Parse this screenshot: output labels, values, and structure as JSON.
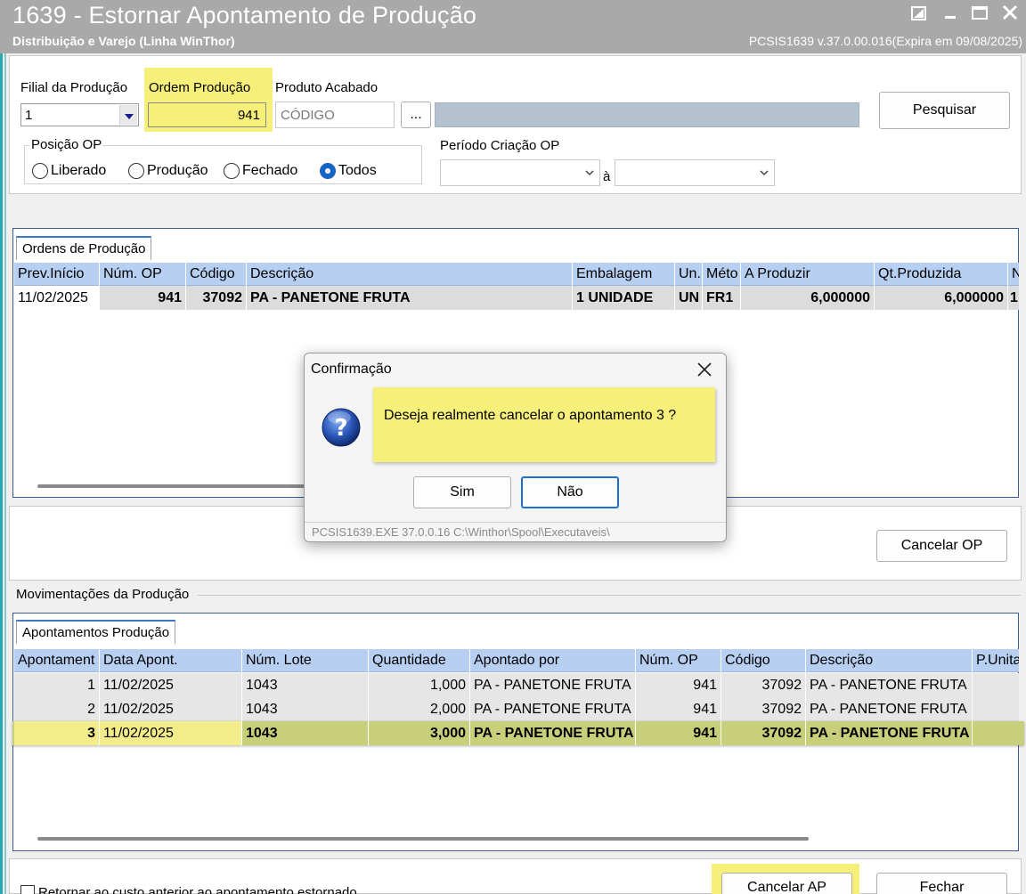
{
  "window": {
    "title": "1639 - Estornar Apontamento de Produção",
    "subtitle": "Distribuição e Varejo (Linha WinThor)",
    "version": "PCSIS1639  v.37.0.00.016(Expira em 09/08/2025)"
  },
  "filters": {
    "filial_label": "Filial da Produção",
    "filial_value": "1",
    "ordem_label": "Ordem Produção",
    "ordem_value": "941",
    "produto_label": "Produto Acabado",
    "produto_placeholder": "CÓDIGO",
    "ellipsis_label": "...",
    "pesquisar_label": "Pesquisar",
    "posicao_label": "Posição OP",
    "posicao_options": [
      "Liberado",
      "Produção",
      "Fechado",
      "Todos"
    ],
    "posicao_selected": "Todos",
    "periodo_label": "Período Criação OP",
    "periodo_sep": "à"
  },
  "ordens": {
    "tab_label": "Ordens de Produção",
    "columns": [
      "Prev.Início",
      "Núm. OP",
      "Código",
      "Descrição",
      "Embalagem",
      "Un.",
      "Méto",
      "A Produzir",
      "Qt.Produzida",
      "N"
    ],
    "rows": [
      [
        "11/02/2025",
        "941",
        "37092",
        "PA - PANETONE FRUTA",
        "1 UNIDADE",
        "UN",
        "FR1",
        "6,000000",
        "6,000000",
        "1"
      ]
    ]
  },
  "middle": {
    "cancelar_op_label": "Cancelar OP",
    "movimentacoes_label": "Movimentações da Produção"
  },
  "apontamentos": {
    "tab_label": "Apontamentos Produção",
    "columns": [
      "Apontament",
      "Data Apont.",
      "Núm. Lote",
      "Quantidade",
      "Apontado por",
      "Núm. OP",
      "Código",
      "Descrição",
      "P.Unita"
    ],
    "rows": [
      [
        "1",
        "11/02/2025",
        "1043",
        "1,000",
        "PA - PANETONE FRUTA",
        "941",
        "37092",
        "PA - PANETONE FRUTA",
        ""
      ],
      [
        "2",
        "11/02/2025",
        "1043",
        "2,000",
        "PA - PANETONE FRUTA",
        "941",
        "37092",
        "PA - PANETONE FRUTA",
        ""
      ],
      [
        "3",
        "11/02/2025",
        "1043",
        "3,000",
        "PA - PANETONE FRUTA",
        "941",
        "37092",
        "PA - PANETONE FRUTA",
        ""
      ]
    ],
    "selected_row": 3
  },
  "bottom": {
    "checkbox_label": "Retornar ao custo anterior ao apontamento estornado",
    "cancelar_ap_label": "Cancelar AP",
    "fechar_label": "Fechar"
  },
  "dialog": {
    "title": "Confirmação",
    "message": "Deseja realmente cancelar o apontamento 3 ?",
    "sim_label": "Sim",
    "nao_label": "Não",
    "footer": "PCSIS1639.EXE 37.0.0.16 C:\\Winthor\\Spool\\Executaveis\\"
  },
  "colors": {
    "highlight": "#f6f07a",
    "header_blue": "#b7cff0",
    "selected_row": "#c8cf7a",
    "titlebar": "#a9a9a9"
  }
}
